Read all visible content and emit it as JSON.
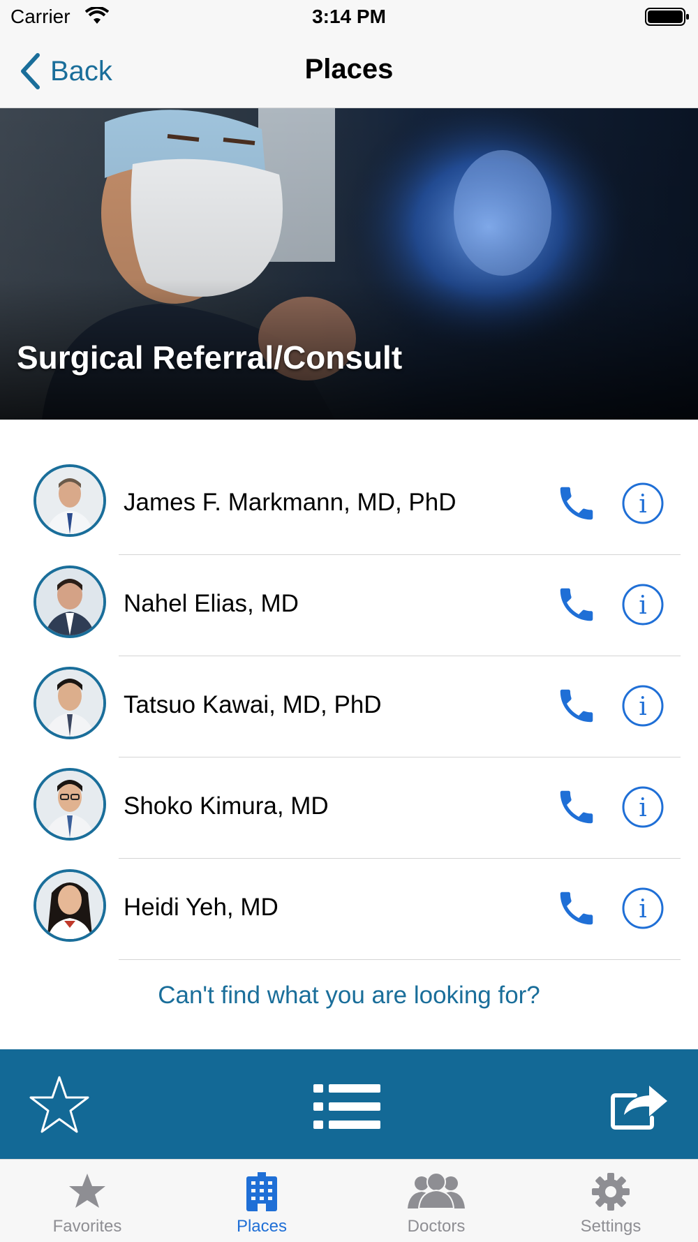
{
  "status_bar": {
    "carrier": "Carrier",
    "time": "3:14 PM"
  },
  "nav": {
    "back_label": "Back",
    "title": "Places"
  },
  "hero": {
    "title": "Surgical Referral/Consult"
  },
  "doctors": [
    {
      "name": "James F. Markmann, MD, PhD"
    },
    {
      "name": "Nahel Elias, MD"
    },
    {
      "name": "Tatsuo Kawai, MD, PhD"
    },
    {
      "name": "Shoko Kimura, MD"
    },
    {
      "name": "Heidi Yeh, MD"
    }
  ],
  "footer_link": "Can't find what you are looking for?",
  "toolbar": {
    "icons": [
      "star-icon",
      "list-icon",
      "share-icon"
    ]
  },
  "tabs": [
    {
      "label": "Favorites",
      "icon": "star-icon"
    },
    {
      "label": "Places",
      "icon": "building-icon"
    },
    {
      "label": "Doctors",
      "icon": "people-icon"
    },
    {
      "label": "Settings",
      "icon": "gear-icon"
    }
  ],
  "colors": {
    "brand": "#136996",
    "accent_blue": "#1f6fd6",
    "link": "#1a6e9a",
    "tab_inactive": "#8e8e93"
  }
}
